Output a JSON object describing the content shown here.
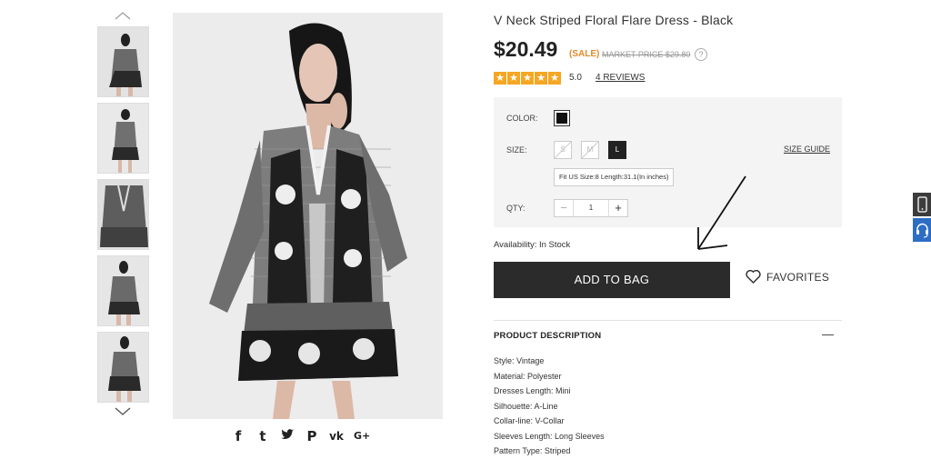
{
  "product": {
    "title": "V Neck Striped Floral Flare Dress - Black",
    "price": "$20.49",
    "sale_tag": "(SALE)",
    "market_price": "MARKET PRICE $29.80",
    "rating": "5.0",
    "stars": 5,
    "reviews_link": "4 REVIEWS",
    "help_glyph": "?"
  },
  "options": {
    "color_label": "COLOR:",
    "selected_color": "#111111",
    "size_label": "SIZE:",
    "sizes": [
      "S",
      "M",
      "L"
    ],
    "selected_size": "L",
    "size_guide": "SIZE GUIDE",
    "fit_info": "Fit US Size:8   Length:31.1(In inches)",
    "qty_label": "QTY:",
    "qty_value": "1",
    "qty_minus": "−",
    "qty_plus": "+"
  },
  "availability": "Availability: In Stock",
  "actions": {
    "add_to_bag": "ADD TO BAG",
    "favorites": "FAVORITES"
  },
  "description": {
    "title": "PRODUCT DESCRIPTION",
    "toggle": "—",
    "specs": [
      "Style: Vintage",
      "Material: Polyester",
      "Dresses Length: Mini",
      "Silhouette: A-Line",
      "Collar-line: V-Collar",
      "Sleeves Length: Long Sleeves",
      "Pattern Type: Striped"
    ]
  },
  "social": [
    "f",
    "t",
    "🐦",
    "P",
    "vk",
    "G+"
  ],
  "icons": {
    "thumb_up": "chevron-up-icon",
    "thumb_down": "chevron-down-icon",
    "favorite": "heart-icon",
    "side_tab_1": "mobile-icon",
    "side_tab_2": "headset-icon"
  },
  "colors": {
    "accent_sale": "#e58a2c",
    "star": "#f5a623",
    "button_dark": "#2b2b2b",
    "side_blue": "#2d6ec4"
  }
}
